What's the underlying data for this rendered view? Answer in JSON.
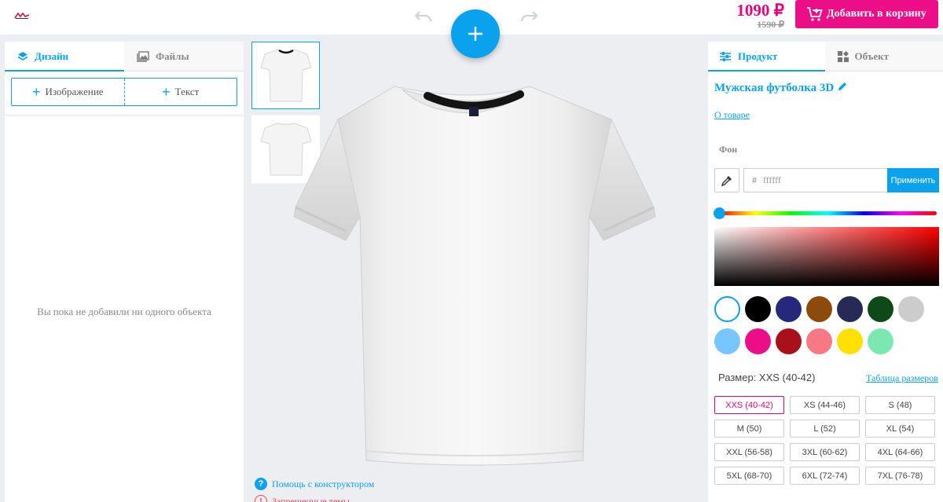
{
  "header": {
    "price_current": "1090 ₽",
    "price_old": "1590 ₽",
    "cart_label": "Добавить в корзину",
    "brand_color": "#ec0e86",
    "accent_color": "#0aa2ec"
  },
  "left_panel": {
    "tabs": [
      {
        "label": "Дизайн",
        "icon": "layers-icon",
        "active": true
      },
      {
        "label": "Файлы",
        "icon": "image-icon",
        "active": false
      }
    ],
    "add_image_label": "Изображение",
    "add_text_label": "Текст",
    "empty_message": "Вы пока не добавили ни одного объекта"
  },
  "stage": {
    "help_label": "Помощь с конструктором",
    "forbidden_label": "Запрещенные темы"
  },
  "right_panel": {
    "tabs": [
      {
        "label": "Продукт",
        "icon": "sliders-icon",
        "active": true
      },
      {
        "label": "Объект",
        "icon": "grid-icon",
        "active": false
      }
    ],
    "product_title": "Мужская футболка 3D",
    "about_link": "О товаре",
    "background_label": "Фон",
    "hex_prefix": "#",
    "hex_value": "ffffff",
    "apply_label": "Применить",
    "swatches": [
      "#ffffff",
      "#000000",
      "#26297a",
      "#8c4a0c",
      "#262a55",
      "#0d4a18",
      "#cccccc",
      "#78c6ff",
      "#ec0e86",
      "#a8101a",
      "#f87984",
      "#ffe000",
      "#7ce8b1"
    ],
    "selected_swatch": 0,
    "size_label": "Размер: XXS (40-42)",
    "size_table_link": "Таблица размеров",
    "sizes": [
      "XXS (40-42)",
      "XS (44-46)",
      "S (48)",
      "M (50)",
      "L (52)",
      "XL (54)",
      "XXL (56-58)",
      "3XL (60-62)",
      "4XL (64-66)",
      "5XL (68-70)",
      "6XL (72-74)",
      "7XL (76-78)"
    ],
    "selected_size": 0
  }
}
